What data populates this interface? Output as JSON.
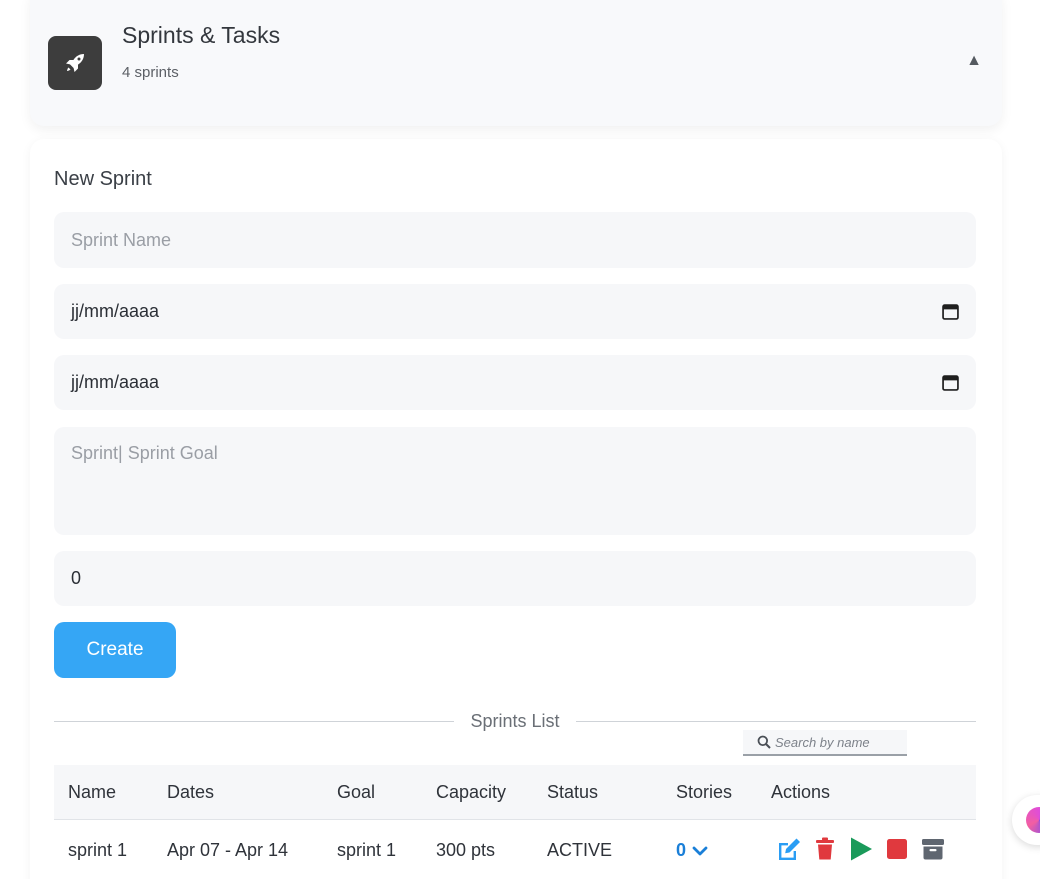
{
  "header": {
    "title": "Sprints & Tasks",
    "subtitle": "4 sprints",
    "toggle": "▲",
    "icon": "rocket-icon"
  },
  "form": {
    "title": "New Sprint",
    "name_placeholder": "Sprint Name",
    "start_date": "jj/mm/aaaa",
    "end_date": "jj/mm/aaaa",
    "goal_placeholder": "Sprint| Sprint Goal",
    "capacity_value": "0",
    "create_label": "Create"
  },
  "list": {
    "title": "Sprints List",
    "search_placeholder": "Search by name",
    "columns": [
      "Name",
      "Dates",
      "Goal",
      "Capacity",
      "Status",
      "Stories",
      "Actions"
    ],
    "rows": [
      {
        "name": "sprint 1",
        "dates": "Apr 07 - Apr 14",
        "goal": "sprint 1",
        "capacity": "300 pts",
        "status": "ACTIVE",
        "stories": "0"
      }
    ]
  },
  "colors": {
    "primary": "#35a6f5",
    "edit": "#2a9df4",
    "delete": "#e0393e",
    "start": "#1a9a5a",
    "stop": "#e0393e",
    "archive": "#5f6670",
    "stories": "#1a7fd8"
  }
}
